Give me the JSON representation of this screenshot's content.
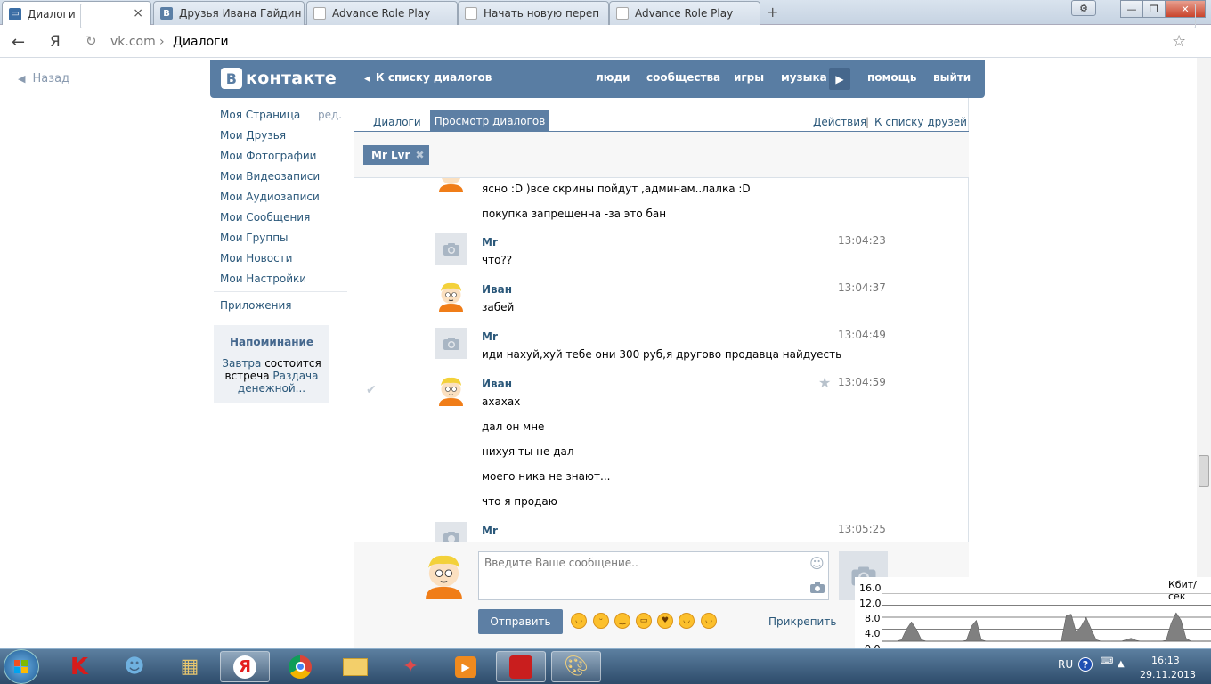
{
  "browser": {
    "tabs": [
      {
        "title": "Диалоги",
        "active": true
      },
      {
        "title": "Друзья Ивана Гайдин"
      },
      {
        "title": "Advance Role Play"
      },
      {
        "title": "Начать новую переп"
      },
      {
        "title": "Advance Role Play"
      }
    ],
    "new_tab": "+",
    "back_icon": "back-arrow-icon",
    "yandex_label": "Я",
    "url_domain": "vk.com",
    "url_sep": "›",
    "url_page": "Диалоги"
  },
  "page": {
    "back_label": "Назад",
    "logo_b": "В",
    "logo_text": "контакте",
    "to_dialogs": "К списку диалогов",
    "nav": [
      "люди",
      "сообщества",
      "игры",
      "музыка",
      "помощь",
      "выйти"
    ],
    "left_menu": [
      "Моя Страница",
      "Мои Друзья",
      "Мои Фотографии",
      "Мои Видеозаписи",
      "Мои Аудиозаписи",
      "Мои Сообщения",
      "Мои Группы",
      "Мои Новости",
      "Мои Настройки"
    ],
    "edit_label": "ред.",
    "apps_label": "Приложения",
    "reminder": {
      "title": "Напоминание",
      "l1a": "Завтра",
      "l1b": " состоится",
      "l2a": "встреча ",
      "l2b": "Раздача",
      "l3": "денежной..."
    },
    "dialog_tabs": {
      "tab1": "Диалоги",
      "tab2": "Просмотр диалогов",
      "actions": "Действия",
      "sep": "|",
      "friends": "К списку друзей"
    },
    "chip": "Mr Lvr",
    "messages": [
      {
        "author": "",
        "time": "",
        "lines": [
          "ясно :D )все скрины пойдут ,админам..лалка :D",
          "покупка запрещенна -за это бан"
        ]
      },
      {
        "author": "Mr",
        "time": "13:04:23",
        "lines": [
          "что??"
        ]
      },
      {
        "author": "Иван",
        "time": "13:04:37",
        "lines": [
          "забей"
        ]
      },
      {
        "author": "Mr",
        "time": "13:04:49",
        "lines": [
          "иди нахуй,хуй тебе они 300 руб,я другово продавца найдуесть"
        ]
      },
      {
        "author": "Иван",
        "time": "13:04:59",
        "lines": [
          "ахахах",
          "дал он мне",
          "нихуя ты не дал",
          "моего ника не знают...",
          "что я продаю"
        ]
      },
      {
        "author": "Mr",
        "time": "13:05:25",
        "lines": []
      }
    ],
    "composer": {
      "placeholder": "Введите Ваше сообщение..",
      "send": "Отправить",
      "attach": "Прикрепить"
    }
  },
  "net_meter": {
    "unit": "Кбит/сек",
    "ticks": [
      "16.0",
      "12.0",
      "8.0",
      "4.0",
      "0.0"
    ],
    "max": 16,
    "samples": [
      0,
      0,
      0,
      0,
      0.5,
      4,
      6.5,
      4,
      0.5,
      0,
      0,
      0,
      0,
      0,
      0,
      0,
      0,
      0.3,
      5,
      7,
      0.5,
      0,
      0,
      0,
      0,
      0,
      0,
      0,
      0,
      0,
      0,
      0,
      0,
      0,
      0,
      0,
      0,
      8.5,
      9,
      3,
      5,
      8,
      4,
      0.5,
      0,
      0,
      0,
      0,
      0,
      0.5,
      1,
      0.3,
      0,
      0,
      0,
      0,
      0,
      0.3,
      6,
      9.5,
      7,
      1,
      0,
      0,
      0,
      0,
      0
    ]
  },
  "taskbar": {
    "lang": "RU",
    "time": "16:13",
    "date": "29.11.2013"
  },
  "colors": {
    "vk_blue": "#597da3",
    "link": "#2b587a",
    "tab_active": "#5d7fa4"
  }
}
